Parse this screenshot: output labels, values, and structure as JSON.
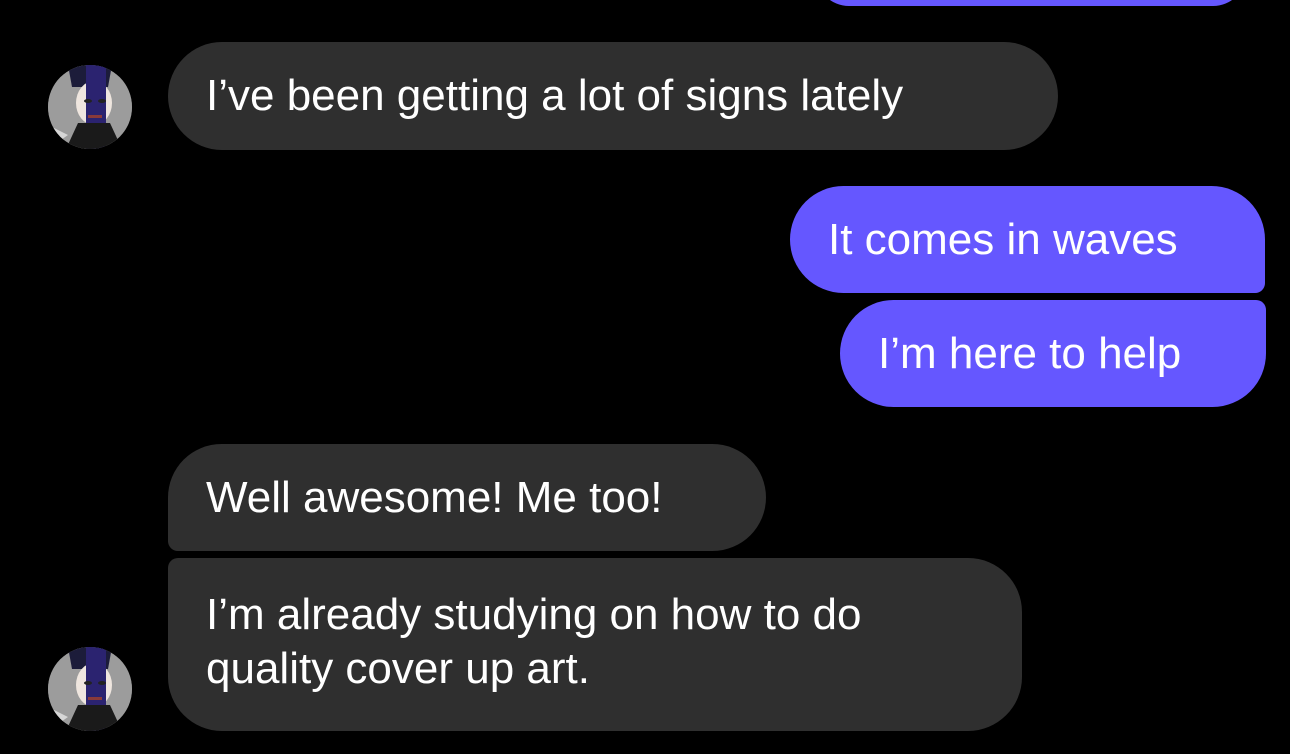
{
  "conversation": {
    "messages": [
      {
        "direction": "incoming",
        "text": "I’ve been getting a lot of signs lately"
      },
      {
        "direction": "outgoing",
        "text": "It comes in waves"
      },
      {
        "direction": "outgoing",
        "text": "I’m here to help"
      },
      {
        "direction": "incoming",
        "text": "Well awesome! Me too!"
      },
      {
        "direction": "incoming",
        "text": "I’m already studying on how to do quality cover up art."
      }
    ]
  },
  "colors": {
    "background": "#000000",
    "incoming_bubble": "#2f2f2f",
    "outgoing_bubble": "#6557ff",
    "text": "#ffffff"
  },
  "icons": {
    "contact_avatar": "contact-avatar"
  }
}
